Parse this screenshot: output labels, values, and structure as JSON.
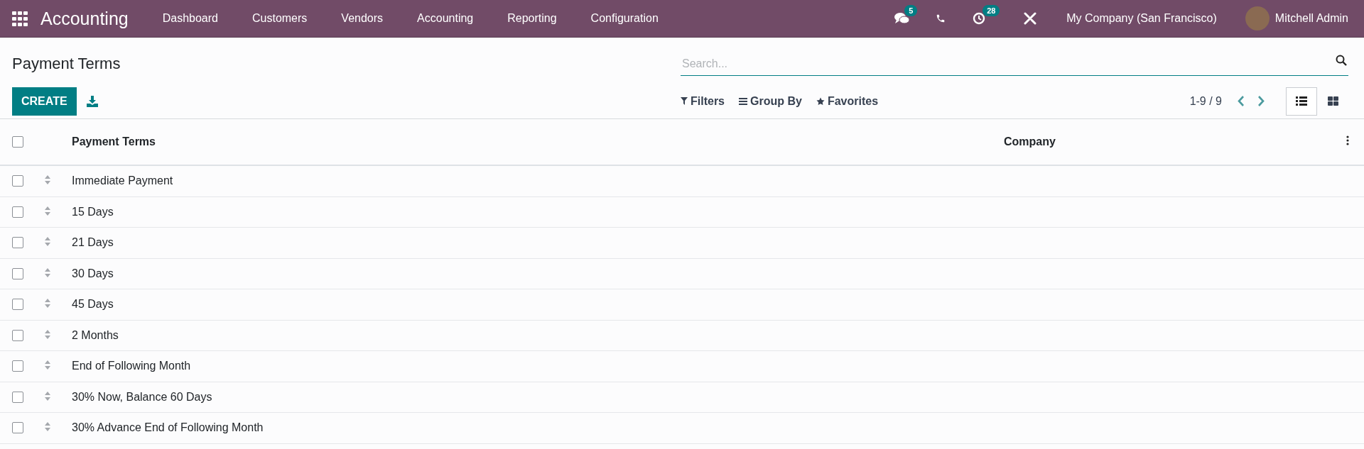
{
  "navbar": {
    "app_name": "Accounting",
    "menu": [
      "Dashboard",
      "Customers",
      "Vendors",
      "Accounting",
      "Reporting",
      "Configuration"
    ],
    "messages_badge": "5",
    "activities_badge": "28",
    "company": "My Company (San Francisco)",
    "user": "Mitchell Admin"
  },
  "control_panel": {
    "title": "Payment Terms",
    "create_label": "CREATE",
    "search": {
      "placeholder": "Search..."
    },
    "filters": [
      {
        "kind": "filter",
        "label": "Filters"
      },
      {
        "kind": "group",
        "label": "Group By"
      },
      {
        "kind": "favorite",
        "label": "Favorites"
      }
    ],
    "pager": "1-9 / 9",
    "views": [
      {
        "kind": "list",
        "selected": true
      },
      {
        "kind": "kanban",
        "selected": false
      }
    ]
  },
  "table": {
    "select_all": {
      "checked": false
    },
    "columns": [
      "Payment Terms",
      "Company"
    ],
    "rows": [
      {
        "name": "Immediate Payment",
        "company": "",
        "checked": false
      },
      {
        "name": "15 Days",
        "company": "",
        "checked": false
      },
      {
        "name": "21 Days",
        "company": "",
        "checked": false
      },
      {
        "name": "30 Days",
        "company": "",
        "checked": false
      },
      {
        "name": "45 Days",
        "company": "",
        "checked": false
      },
      {
        "name": "2 Months",
        "company": "",
        "checked": false
      },
      {
        "name": "End of Following Month",
        "company": "",
        "checked": false
      },
      {
        "name": "30% Now, Balance 60 Days",
        "company": "",
        "checked": false
      },
      {
        "name": "30% Advance End of Following Month",
        "company": "",
        "checked": false
      }
    ]
  }
}
